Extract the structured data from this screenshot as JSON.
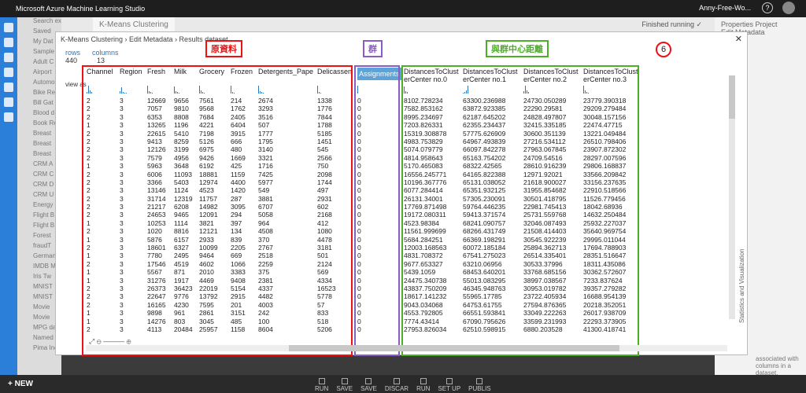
{
  "app": {
    "title": "Microsoft Azure Machine Learning Studio",
    "user": "Anny-Free-Wo...",
    "help_icon": "?"
  },
  "background": {
    "tab_title": "K-Means Clustering",
    "status": "Finished running ✓",
    "left_items": [
      "Search experiment",
      "Saved",
      "My Dat",
      "Sample",
      "Adult C",
      "Airport",
      "Automo",
      "Bike Re",
      "Bill Gat",
      "Blood d",
      "Book Re",
      "Breast",
      "Breast",
      "Breast",
      "CRM A",
      "CRM C",
      "CRM D",
      "CRM U",
      "Energy",
      "Flight B",
      "Flight B",
      "Forest",
      "fraudT",
      "German",
      "IMDB M",
      "Iris Tw",
      "MNIST",
      "MNIST",
      "Movie",
      "Movie",
      "MPG da",
      "Named E",
      "Pima Indi"
    ],
    "right_header": [
      "Properties",
      "Project"
    ],
    "right_sub": "Edit Metadata",
    "right_context": "associated with columns in a dataset."
  },
  "bottom": {
    "new_label": "+ NEW",
    "actions": [
      "RUN",
      "SAVE",
      "SAVE",
      "DISCAR",
      "RUN",
      "SET UP",
      "PUBLIS"
    ]
  },
  "dialog": {
    "breadcrumb": "K-Means Clustering › Edit Metadata › Results dataset",
    "rows_label": "rows",
    "rows_value": "440",
    "columns_label": "columns",
    "columns_value": "13",
    "view_as": "view as",
    "side_panel": "Statistics and Visualization",
    "annotations": {
      "raw": "原資料",
      "cluster": "群",
      "distance": "與群中心距離",
      "step": "6"
    },
    "headers": [
      "Channel",
      "Region",
      "Fresh",
      "Milk",
      "Grocery",
      "Frozen",
      "Detergents_Pape",
      "Delicassen",
      "Assignments",
      "DistancesToClust erCenter no.0",
      "DistancesToClust erCenter no.1",
      "DistancesToClust erCenter no.2",
      "DistancesToClust erCenter no.3"
    ],
    "rows": [
      [
        "2",
        "3",
        "12669",
        "9656",
        "7561",
        "214",
        "2674",
        "1338",
        "0",
        "8102.728234",
        "63300.236988",
        "24730.050289",
        "23779.390318"
      ],
      [
        "2",
        "3",
        "7057",
        "9810",
        "9568",
        "1762",
        "3293",
        "1776",
        "0",
        "7582.853162",
        "63872.923385",
        "22290.29581",
        "29209.279484"
      ],
      [
        "2",
        "3",
        "6353",
        "8808",
        "7684",
        "2405",
        "3516",
        "7844",
        "0",
        "8995.234697",
        "62187.645202",
        "24828.497807",
        "30048.157156"
      ],
      [
        "1",
        "3",
        "13265",
        "1196",
        "4221",
        "6404",
        "507",
        "1788",
        "0",
        "7203.826331",
        "62355.234437",
        "32415.335185",
        "22474.47715"
      ],
      [
        "2",
        "3",
        "22615",
        "5410",
        "7198",
        "3915",
        "1777",
        "5185",
        "0",
        "15319.308878",
        "57775.626909",
        "30600.351139",
        "13221.049484"
      ],
      [
        "2",
        "3",
        "9413",
        "8259",
        "5126",
        "666",
        "1795",
        "1451",
        "0",
        "4983.753829",
        "64967.493839",
        "27216.534112",
        "26510.798406"
      ],
      [
        "2",
        "3",
        "12126",
        "3199",
        "6975",
        "480",
        "3140",
        "545",
        "0",
        "5074.079779",
        "66097.842278",
        "27963.067845",
        "23907.872302"
      ],
      [
        "2",
        "3",
        "7579",
        "4956",
        "9426",
        "1669",
        "3321",
        "2566",
        "0",
        "4814.958643",
        "65163.754202",
        "24709.54516",
        "28297.007596"
      ],
      [
        "1",
        "3",
        "5963",
        "3648",
        "6192",
        "425",
        "1716",
        "750",
        "0",
        "5170.465083",
        "68322.42565",
        "28610.916239",
        "29806.168837"
      ],
      [
        "2",
        "3",
        "6006",
        "11093",
        "18881",
        "1159",
        "7425",
        "2098",
        "0",
        "16556.245771",
        "64165.822388",
        "12971.92021",
        "33566.209842"
      ],
      [
        "2",
        "3",
        "3366",
        "5403",
        "12974",
        "4400",
        "5977",
        "1744",
        "0",
        "10196.367776",
        "65131.038052",
        "21618.900027",
        "33156.237635"
      ],
      [
        "2",
        "3",
        "13146",
        "1124",
        "4523",
        "1420",
        "549",
        "497",
        "0",
        "6077.284414",
        "65351.932125",
        "31955.854682",
        "22910.518566"
      ],
      [
        "2",
        "3",
        "31714",
        "12319",
        "11757",
        "287",
        "3881",
        "2931",
        "0",
        "26131.34001",
        "57305.230091",
        "30501.418795",
        "11526.779456"
      ],
      [
        "2",
        "3",
        "21217",
        "6208",
        "14982",
        "3095",
        "6707",
        "602",
        "0",
        "17769.871498",
        "59764.446235",
        "22981.745413",
        "18042.68936"
      ],
      [
        "2",
        "3",
        "24653",
        "9465",
        "12091",
        "294",
        "5058",
        "2168",
        "0",
        "19172.080311",
        "59413.371574",
        "25731.559768",
        "14632.250484"
      ],
      [
        "1",
        "3",
        "10253",
        "1114",
        "3821",
        "397",
        "964",
        "412",
        "0",
        "4523.98384",
        "68241.090757",
        "32046.087493",
        "25932.227037"
      ],
      [
        "2",
        "3",
        "1020",
        "8816",
        "12121",
        "134",
        "4508",
        "1080",
        "0",
        "11561.999699",
        "68266.431749",
        "21508.414403",
        "35640.969754"
      ],
      [
        "1",
        "3",
        "5876",
        "6157",
        "2933",
        "839",
        "370",
        "4478",
        "0",
        "5684.284251",
        "66369.198291",
        "30545.922239",
        "29995.011044"
      ],
      [
        "2",
        "3",
        "18601",
        "6327",
        "10099",
        "2205",
        "2767",
        "3181",
        "0",
        "12003.168563",
        "60072.185184",
        "25894.362713",
        "17694.788903"
      ],
      [
        "1",
        "3",
        "7780",
        "2495",
        "9464",
        "669",
        "2518",
        "501",
        "0",
        "4831.708372",
        "67541.275023",
        "26514.335401",
        "28351.516647"
      ],
      [
        "2",
        "3",
        "17546",
        "4519",
        "4602",
        "1066",
        "2259",
        "2124",
        "0",
        "9677.653327",
        "63210.06956",
        "30533.37996",
        "18311.435086"
      ],
      [
        "1",
        "3",
        "5567",
        "871",
        "2010",
        "3383",
        "375",
        "569",
        "0",
        "5439.1059",
        "68453.640201",
        "33768.685156",
        "30362.572607"
      ],
      [
        "1",
        "3",
        "31276",
        "1917",
        "4469",
        "9408",
        "2381",
        "4334",
        "0",
        "24475.340738",
        "55013.083295",
        "38997.038567",
        "7233.837624"
      ],
      [
        "2",
        "3",
        "26373",
        "36423",
        "22019",
        "5154",
        "4337",
        "16523",
        "0",
        "43837.750209",
        "46345.948763",
        "30953.019782",
        "39357.279282"
      ],
      [
        "2",
        "3",
        "22647",
        "9776",
        "13792",
        "2915",
        "4482",
        "5778",
        "0",
        "18617.141232",
        "55965.17785",
        "23722.405934",
        "16688.954139"
      ],
      [
        "2",
        "3",
        "16165",
        "4230",
        "7595",
        "201",
        "4003",
        "57",
        "0",
        "9043.034068",
        "64753.61755",
        "27594.876365",
        "20218.352051"
      ],
      [
        "1",
        "3",
        "9898",
        "961",
        "2861",
        "3151",
        "242",
        "833",
        "0",
        "4553.792805",
        "66551.593841",
        "33049.222263",
        "26017.938709"
      ],
      [
        "1",
        "3",
        "14276",
        "803",
        "3045",
        "485",
        "100",
        "518",
        "0",
        "7774.43414",
        "67090.795626",
        "33599.231993",
        "22293.373905"
      ],
      [
        "2",
        "3",
        "4113",
        "20484",
        "25957",
        "1158",
        "8604",
        "5206",
        "0",
        "27953.826034",
        "62510.598915",
        "6880.203528",
        "41300.418741"
      ]
    ]
  },
  "colors": {
    "red": "#e11111",
    "purple": "#8a5cc6",
    "green": "#4caf25",
    "nav_blue": "#2b7fd8",
    "selected_header": "#5ba3d9"
  }
}
